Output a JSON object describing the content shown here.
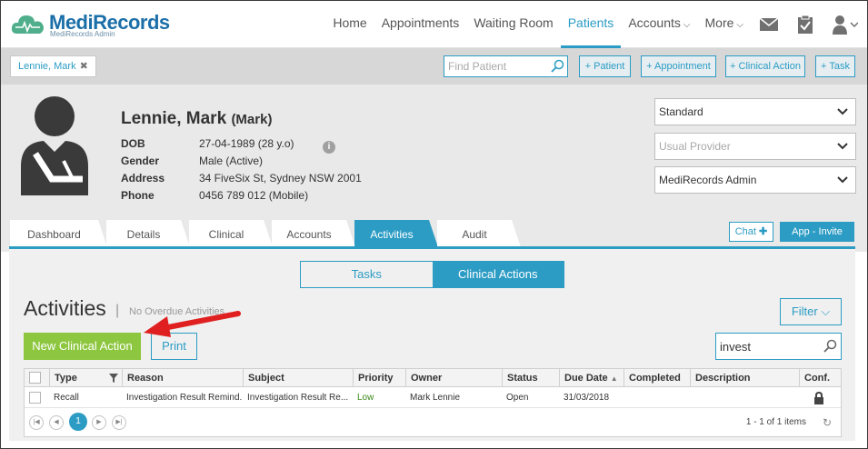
{
  "app": {
    "logo_main": "MediRecords",
    "logo_sub": "MediRecords Admin"
  },
  "nav": {
    "items": [
      {
        "label": "Home"
      },
      {
        "label": "Appointments"
      },
      {
        "label": "Waiting Room"
      },
      {
        "label": "Patients",
        "active": true
      },
      {
        "label": "Accounts"
      },
      {
        "label": "More"
      }
    ],
    "icons": [
      "mail-icon",
      "clipboard-check-icon",
      "user-icon"
    ]
  },
  "strip": {
    "patient_tab": "Lennie, Mark",
    "find_placeholder": "Find Patient",
    "buttons": [
      "+ Patient",
      "+ Appointment",
      "+ Clinical Action",
      "+ Task"
    ]
  },
  "patient": {
    "name": "Lennie, Mark",
    "nickname": "(Mark)",
    "fields": [
      {
        "label": "DOB",
        "value": "27-04-1989 (28 y.o)"
      },
      {
        "label": "Gender",
        "value": "Male (Active)"
      },
      {
        "label": "Address",
        "value": "34 FiveSix St, Sydney NSW 2001"
      },
      {
        "label": "Phone",
        "value": "0456 789 012 (Mobile)"
      }
    ],
    "info_icon": "i",
    "selects": {
      "billing": "Standard",
      "provider_placeholder": "Usual Provider",
      "practice": "MediRecords Admin"
    }
  },
  "tabs": [
    {
      "label": "Dashboard"
    },
    {
      "label": "Details"
    },
    {
      "label": "Clinical"
    },
    {
      "label": "Accounts"
    },
    {
      "label": "Activities",
      "active": true
    },
    {
      "label": "Audit"
    }
  ],
  "tab_buttons": {
    "chat": "Chat",
    "invite": "App - Invite"
  },
  "activities": {
    "segments": [
      "Tasks",
      "Clinical Actions"
    ],
    "active_segment": "Clinical Actions",
    "heading": "Activities",
    "separator": "|",
    "overdue": "No Overdue Activities",
    "filter_label": "Filter",
    "new_button": "New Clinical Action",
    "print_button": "Print",
    "search_value": "invest"
  },
  "table": {
    "columns": [
      "Type",
      "Reason",
      "Subject",
      "Priority",
      "Owner",
      "Status",
      "Due Date",
      "Completed",
      "Description",
      "Conf."
    ],
    "rows": [
      {
        "type": "Recall",
        "reason": "Investigation Result Remind...",
        "subject": "Investigation Result Re...",
        "priority": "Low",
        "owner": "Mark Lennie",
        "status": "Open",
        "due_date": "31/03/2018",
        "completed": "",
        "description": "",
        "conf": "lock-icon"
      }
    ],
    "page": "1",
    "page_info": "1 - 1 of 1 items"
  },
  "colors": {
    "accent": "#2c9cc4",
    "green": "#8dc63f",
    "priority_low": "#3a8a1a",
    "arrow": "#e02020"
  }
}
